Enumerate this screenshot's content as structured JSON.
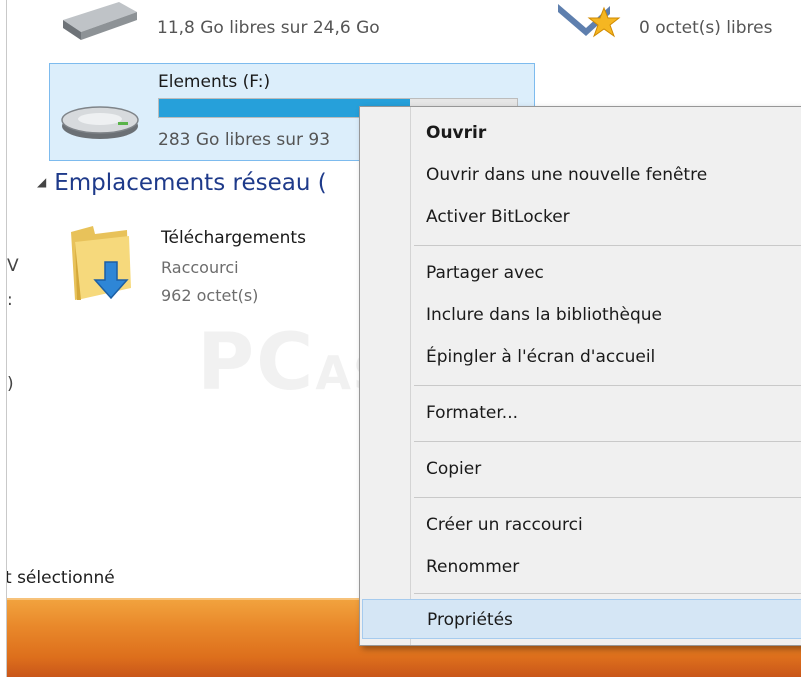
{
  "drives": {
    "top_drive": {
      "free_text": "11,8 Go libres sur 24,6 Go",
      "icon": "hard-drive-icon"
    },
    "favorites": {
      "free_text": "0 octet(s) libres",
      "icon": "star-drive-icon"
    },
    "selected_drive": {
      "name": "Elements (F:)",
      "free_text": "283 Go libres sur 93",
      "capacity_used_fraction": 0.7,
      "icon": "hard-drive-icon"
    }
  },
  "network_group": {
    "header": "Emplacements réseau (",
    "item": {
      "name": "Téléchargements",
      "type": "Raccourci",
      "size": "962 octet(s)",
      "icon": "folder-shortcut-icon"
    }
  },
  "left_edge_glyphs": [
    "V",
    ":",
    ")"
  ],
  "status_bar": {
    "text": "t sélectionné"
  },
  "watermark": {
    "big": "PC",
    "small": "ASTUCES"
  },
  "context_menu": {
    "items": [
      {
        "label": "Ouvrir",
        "bold": true
      },
      {
        "label": "Ouvrir dans une nouvelle fenêtre"
      },
      {
        "label": "Activer BitLocker"
      },
      {
        "label": "Partager avec"
      },
      {
        "label": "Inclure dans la bibliothèque"
      },
      {
        "label": "Épingler à l'écran d'accueil"
      },
      {
        "label": "Formater..."
      },
      {
        "label": "Copier"
      },
      {
        "label": "Créer un raccourci"
      },
      {
        "label": "Renommer"
      },
      {
        "label": "Propriétés",
        "highlighted": true
      }
    ]
  },
  "colors": {
    "selection_bg": "#dceefb",
    "selection_border": "#7dbbee",
    "capacity_fill": "#26a0da",
    "taskbar": "#e9892b",
    "menu_bg": "#f0f0f0",
    "group_header": "#1e3a8a"
  }
}
